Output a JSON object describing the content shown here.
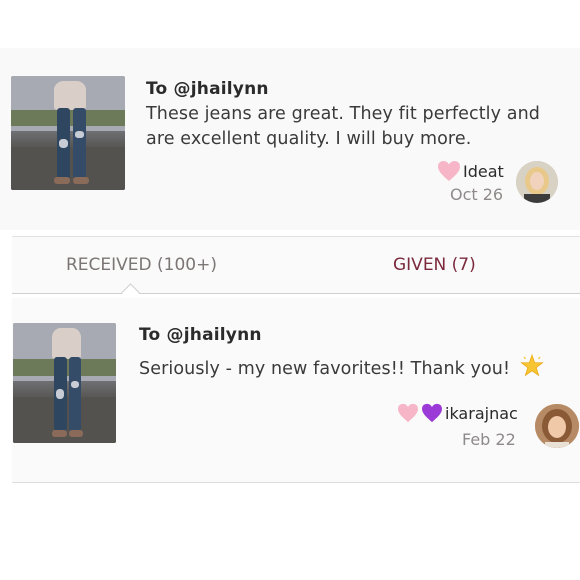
{
  "notes": [
    {
      "to": "To @jhailynn",
      "message_lines": [
        "These jeans are great. They fit perfectly and",
        "are excellent quality. I will buy more."
      ],
      "sender": "Ideat",
      "date": "Oct 26",
      "reaction_icons": [
        "pink-heart-icon"
      ]
    },
    {
      "to": "To @jhailynn",
      "message": "Seriously - my new favorites!! Thank you!",
      "sender": "ikarajnac",
      "date": "Feb 22",
      "reaction_icons": [
        "pink-heart-icon",
        "purple-heart-icon"
      ],
      "trailing_icon": "glowing-star-icon"
    }
  ],
  "tabs": {
    "received_label": "RECEIVED",
    "received_count": "(100+)",
    "given_label": "GIVEN (7)"
  },
  "colors": {
    "given_tab": "#7a2a3c",
    "pink_heart": "#f6b6c8",
    "purple_heart": "#9b3ad6"
  }
}
